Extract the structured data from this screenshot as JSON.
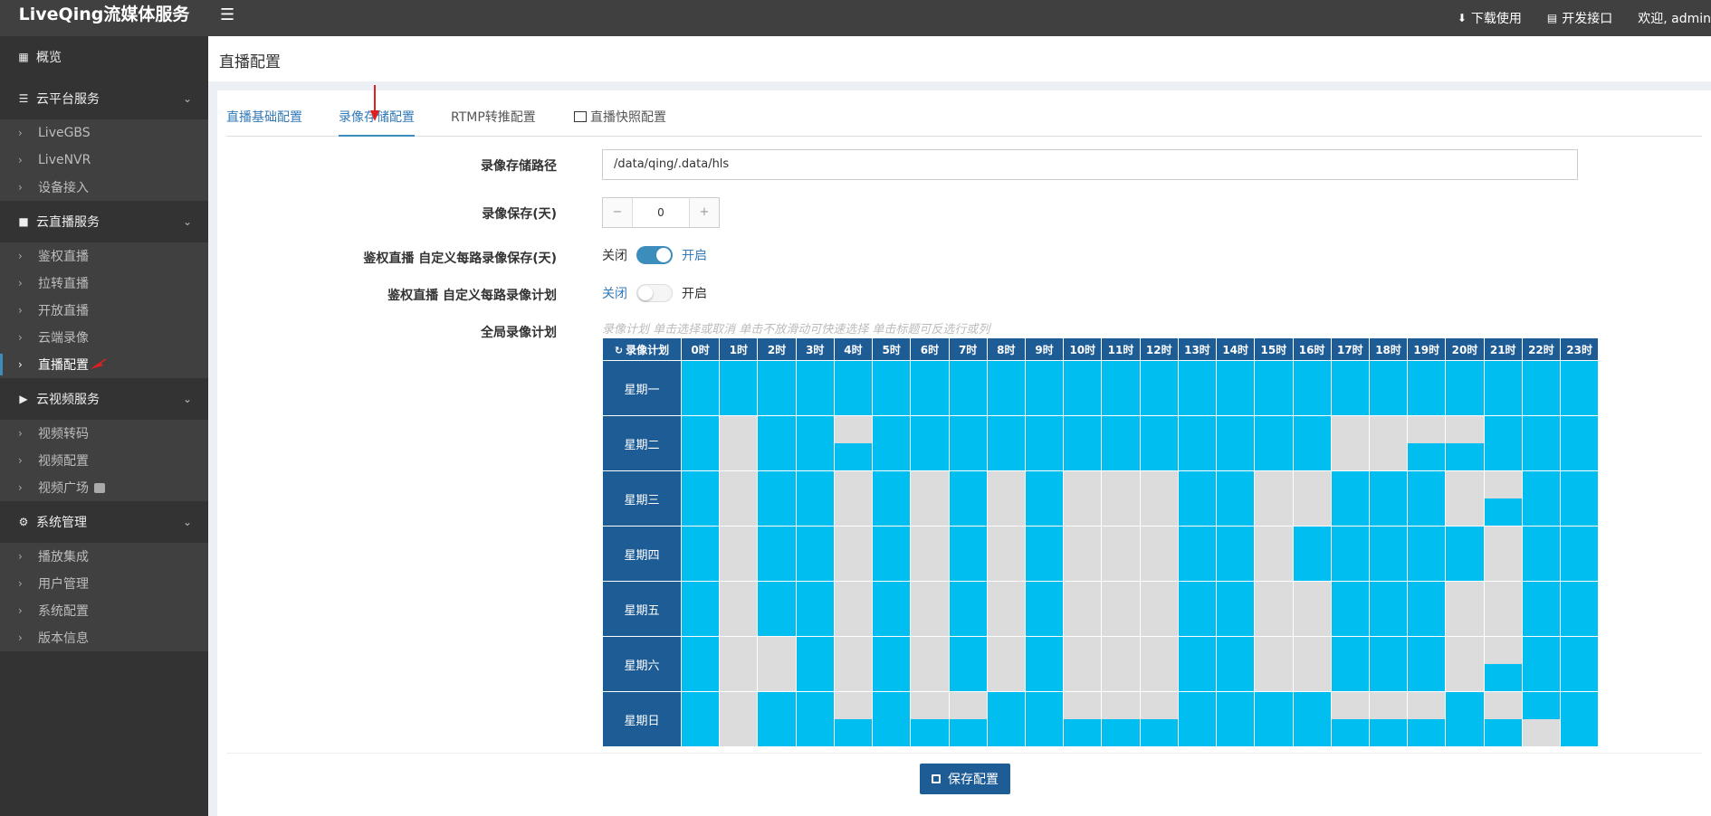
{
  "topbar": {
    "app_title": "LiveQing流媒体服务",
    "download_label": "下载使用",
    "api_label": "开发接口",
    "welcome_label": "欢迎, admin"
  },
  "sidebar": {
    "overview": "概览",
    "groups": [
      {
        "label": "云平台服务",
        "items": [
          "LiveGBS",
          "LiveNVR",
          "设备接入"
        ]
      },
      {
        "label": "云直播服务",
        "items": [
          "鉴权直播",
          "拉转直播",
          "开放直播",
          "云端录像",
          "直播配置"
        ]
      },
      {
        "label": "云视频服务",
        "items": [
          "视频转码",
          "视频配置",
          "视频广场"
        ]
      },
      {
        "label": "系统管理",
        "items": [
          "播放集成",
          "用户管理",
          "系统配置",
          "版本信息"
        ]
      }
    ]
  },
  "page": {
    "title": "直播配置"
  },
  "tabs": [
    "直播基础配置",
    "录像存储配置",
    "RTMP转推配置",
    "直播快照配置"
  ],
  "form": {
    "storage_path_label": "录像存储路径",
    "storage_path_value": "/data/qing/.data/hls",
    "retention_label": "录像保存(天)",
    "retention_value": "0",
    "retention_minus": "−",
    "retention_plus": "+",
    "custom_retention_label": "鉴权直播 自定义每路录像保存(天)",
    "custom_retention_state": "on",
    "custom_plan_label": "鉴权直播 自定义每路录像计划",
    "custom_plan_state": "off",
    "switch_off": "关闭",
    "switch_on": "开启",
    "global_plan_label": "全局录像计划",
    "global_plan_hint": "录像计划 单击选择或取消 单击不放滑动可快速选择 单击标题可反选行或列"
  },
  "schedule": {
    "header": "录像计划",
    "hours": [
      "0时",
      "1时",
      "2时",
      "3时",
      "4时",
      "5时",
      "6时",
      "7时",
      "8时",
      "9时",
      "10时",
      "11时",
      "12时",
      "13时",
      "14时",
      "15时",
      "16时",
      "17时",
      "18时",
      "19时",
      "20时",
      "21时",
      "22时",
      "23时"
    ],
    "days": [
      "星期一",
      "星期二",
      "星期三",
      "星期四",
      "星期五",
      "星期六",
      "星期日"
    ],
    "off_slots": {
      "1": [
        2,
        3,
        8,
        34,
        35,
        36,
        37,
        38,
        40
      ],
      "2": [
        2,
        3,
        8,
        9,
        12,
        13,
        16,
        17,
        20,
        21,
        22,
        23,
        24,
        25,
        30,
        31,
        32,
        33,
        40,
        41,
        42
      ],
      "3": [
        2,
        3,
        8,
        9,
        12,
        13,
        16,
        17,
        20,
        21,
        22,
        23,
        24,
        25,
        30,
        31,
        42,
        43
      ],
      "4": [
        2,
        3,
        8,
        9,
        12,
        13,
        16,
        17,
        20,
        21,
        22,
        23,
        24,
        25,
        30,
        31,
        32,
        33,
        40,
        41,
        42,
        43
      ],
      "5": [
        2,
        3,
        4,
        5,
        8,
        9,
        12,
        13,
        16,
        17,
        20,
        21,
        22,
        23,
        24,
        25,
        30,
        31,
        32,
        33,
        40,
        41,
        42
      ],
      "6": [
        2,
        3,
        8,
        12,
        14,
        20,
        22,
        24,
        34,
        36,
        38,
        42,
        45
      ]
    }
  },
  "save_label": "保存配置",
  "colors": {
    "topbar": "#404040",
    "sidebar": "#333333",
    "accent": "#3c8dbc",
    "slot_on": "#00bff0",
    "slot_off": "#dcdcdc",
    "header_blue": "#1e5c96"
  }
}
